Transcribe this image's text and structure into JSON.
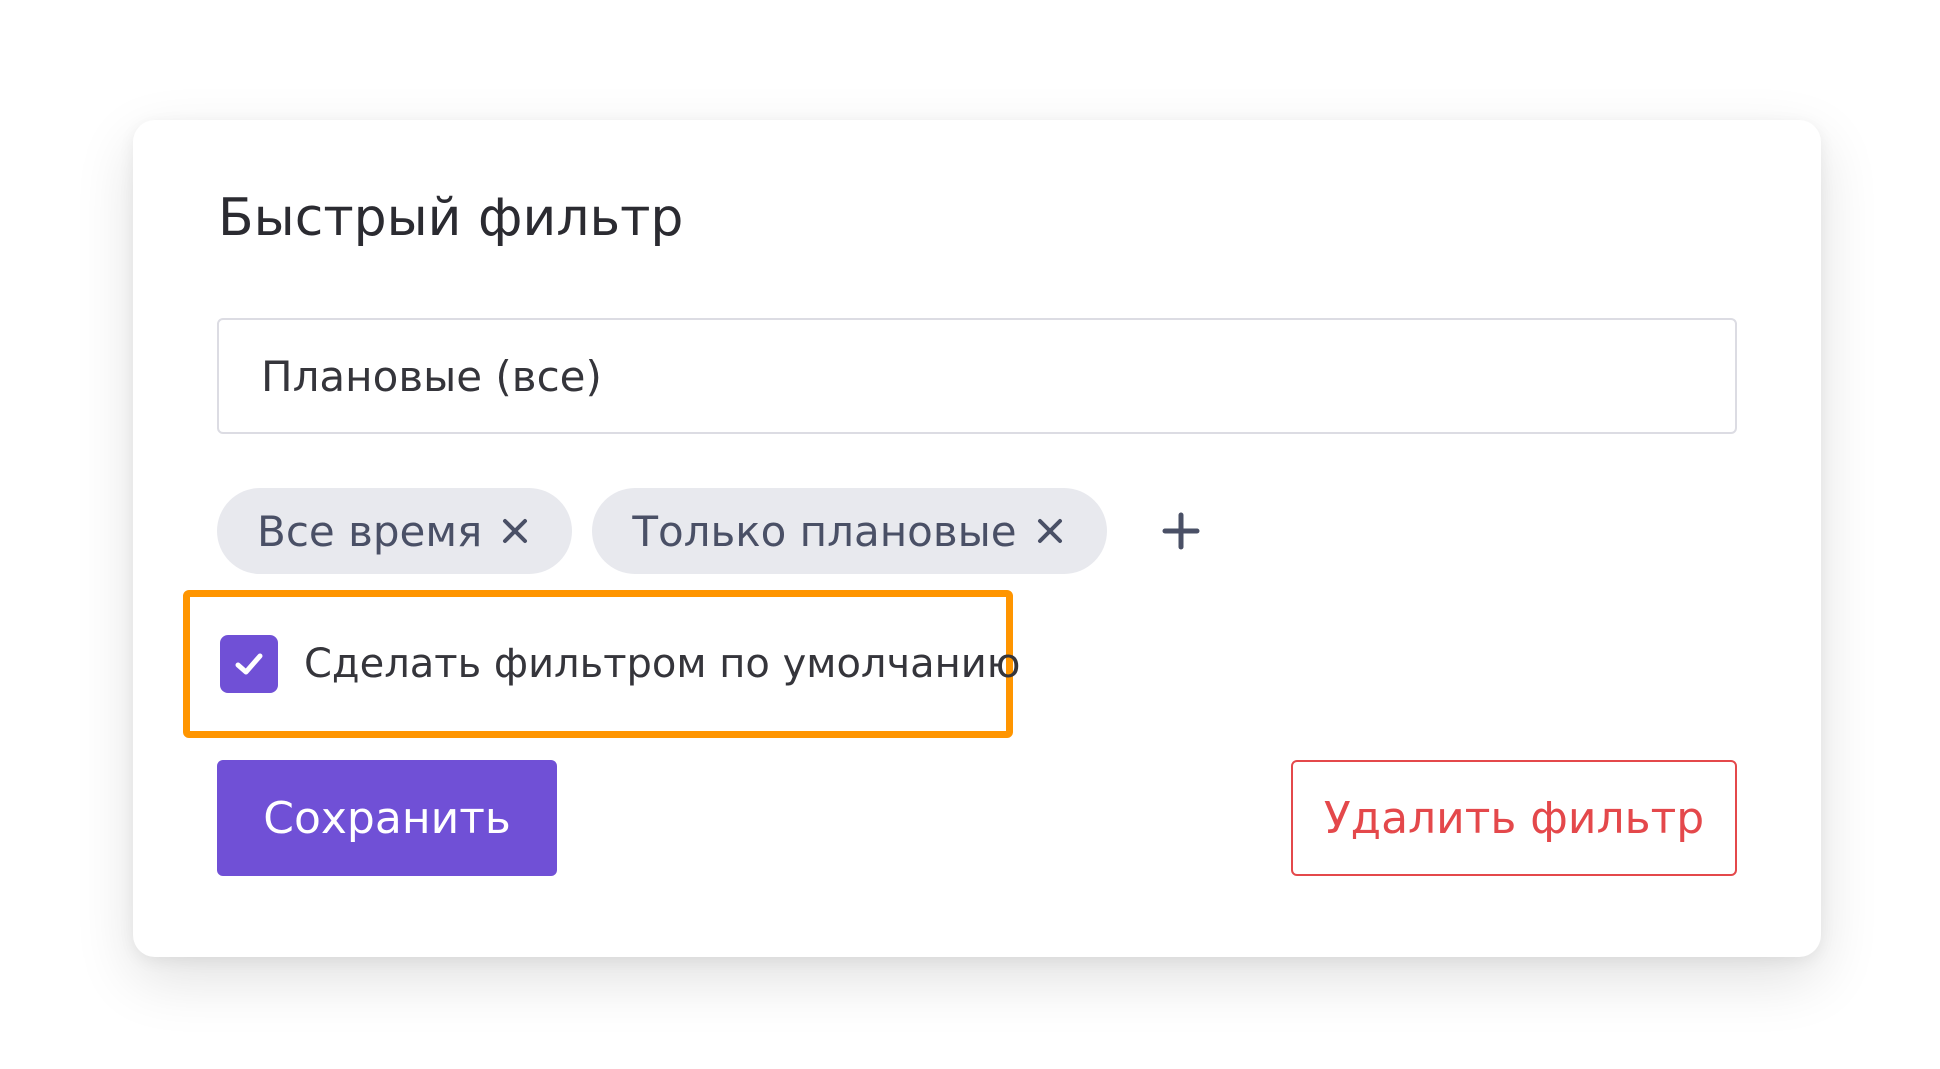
{
  "dialog": {
    "title": "Быстрый фильтр"
  },
  "filter_name": {
    "value": "Плановые (все)"
  },
  "chips": [
    {
      "label": "Все время"
    },
    {
      "label": "Только плановые"
    }
  ],
  "default_option": {
    "label": "Сделать фильтром по умолчанию",
    "checked": true
  },
  "actions": {
    "save_label": "Сохранить",
    "delete_label": "Удалить фильтр"
  },
  "icons": {
    "chip_remove": "close-icon",
    "add_chip": "plus-icon",
    "checkbox": "checkmark-icon"
  },
  "colors": {
    "accent": "#7050d6",
    "danger": "#e4484b",
    "highlight": "#ff9500",
    "chip_bg": "#e8e9ee"
  }
}
